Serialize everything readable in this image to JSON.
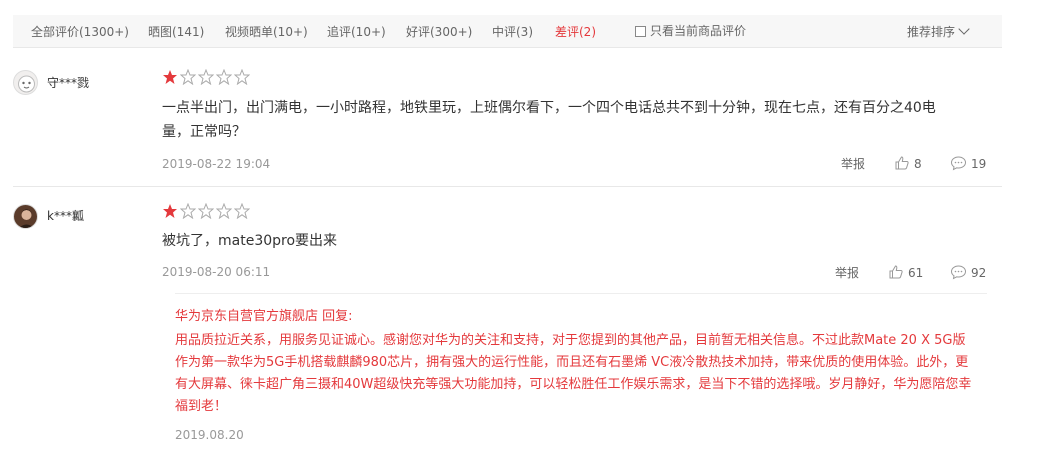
{
  "filter_tabs": [
    {
      "label": "全部评价(1300+)"
    },
    {
      "label": "晒图(141)"
    },
    {
      "label": "视频晒单(10+)"
    },
    {
      "label": "追评(10+)"
    },
    {
      "label": "好评(300+)"
    },
    {
      "label": "中评(3)"
    },
    {
      "label": "差评(2)"
    }
  ],
  "only_current_label": "只看当前商品评价",
  "sort_label": "推荐排序",
  "colors": {
    "accent_red": "#e4393c",
    "text_gray": "#999999"
  },
  "reviews": [
    {
      "username": "守***戮",
      "rating": 1,
      "content": "一点半出门，出门满电，一小时路程，地铁里玩，上班偶尔看下，一个四个电话总共不到十分钟，现在七点，还有百分之40电量，正常吗？",
      "date": "2019-08-22 19:04",
      "report_label": "举报",
      "likes": "8",
      "comments": "19"
    },
    {
      "username": "k***瓤",
      "rating": 1,
      "content": "被坑了，mate30pro要出来",
      "date": "2019-08-20 06:11",
      "report_label": "举报",
      "likes": "61",
      "comments": "92",
      "reply": {
        "title": "华为京东自营官方旗舰店 回复:",
        "text": "用品质拉近关系，用服务见证诚心。感谢您对华为的关注和支持，对于您提到的其他产品，目前暂无相关信息。不过此款Mate 20 X 5G版作为第一款华为5G手机搭载麒麟980芯片，拥有强大的运行性能，而且还有石墨烯 VC液冷散热技术加持，带来优质的使用体验。此外，更有大屏幕、徕卡超广角三摄和40W超级快充等强大功能加持，可以轻松胜任工作娱乐需求，是当下不错的选择哦。岁月静好，华为愿陪您幸福到老！",
        "date": "2019.08.20"
      }
    }
  ]
}
